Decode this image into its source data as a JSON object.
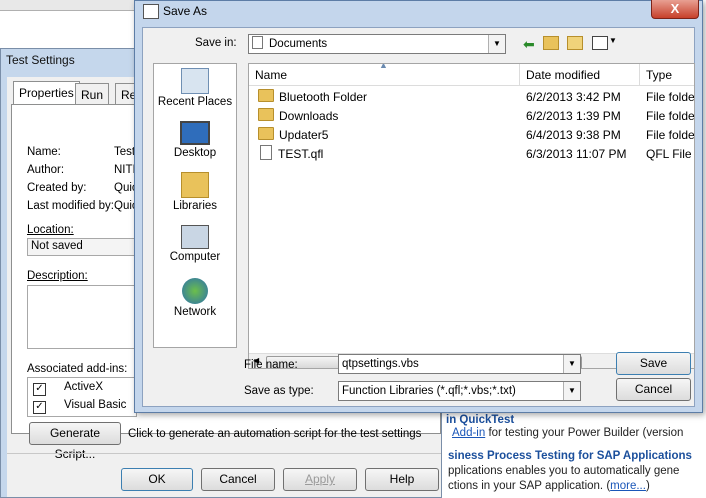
{
  "background": {
    "text_heading": "in QuickTest",
    "line1_link": "Add-in",
    "line1_rest": " for testing your Power Builder (version",
    "line2": "siness Process Testing for SAP Applications",
    "line3": "pplications enables you to automatically gene",
    "line4_text": "ctions in your SAP application. (",
    "line4_link": "more...",
    "line4_end": ")"
  },
  "test_settings": {
    "title": "Test Settings",
    "tabs": [
      "Properties",
      "Run",
      "Re"
    ],
    "name_label": "Name:",
    "name_value": "Test",
    "author_label": "Author:",
    "author_value": "NITI",
    "created_label": "Created by:",
    "created_value": "Quic",
    "modified_label": "Last modified by:",
    "modified_value": "Quic",
    "location_label": "Location:",
    "location_value": "Not saved",
    "description_label": "Description:",
    "addins_label": "Associated add-ins:",
    "addins": [
      "ActiveX",
      "Visual Basic"
    ],
    "generate_label": "Generate Script...",
    "generate_hint": "Click to generate an automation script for the test settings",
    "ok_label": "OK",
    "cancel_label": "Cancel",
    "apply_label": "Apply",
    "help_label": "Help"
  },
  "save_as": {
    "title": "Save As",
    "close_label": "X",
    "save_in_label": "Save in:",
    "save_in_value": "Documents",
    "places": [
      "Recent Places",
      "Desktop",
      "Libraries",
      "Computer",
      "Network"
    ],
    "columns": {
      "name": "Name",
      "date": "Date modified",
      "type": "Type"
    },
    "files": [
      {
        "name": "Bluetooth Folder",
        "date": "6/2/2013 3:42 PM",
        "type": "File folder"
      },
      {
        "name": "Downloads",
        "date": "6/2/2013 1:39 PM",
        "type": "File folder"
      },
      {
        "name": "Updater5",
        "date": "6/4/2013 9:38 PM",
        "type": "File folder"
      },
      {
        "name": "TEST.qfl",
        "date": "6/3/2013 11:07 PM",
        "type": "QFL File"
      }
    ],
    "filename_label": "File name:",
    "filename_value": "qtpsettings.vbs",
    "savetype_label": "Save as type:",
    "savetype_value": "Function Libraries (*.qfl;*.vbs;*.txt)",
    "save_label": "Save",
    "cancel_label": "Cancel"
  }
}
